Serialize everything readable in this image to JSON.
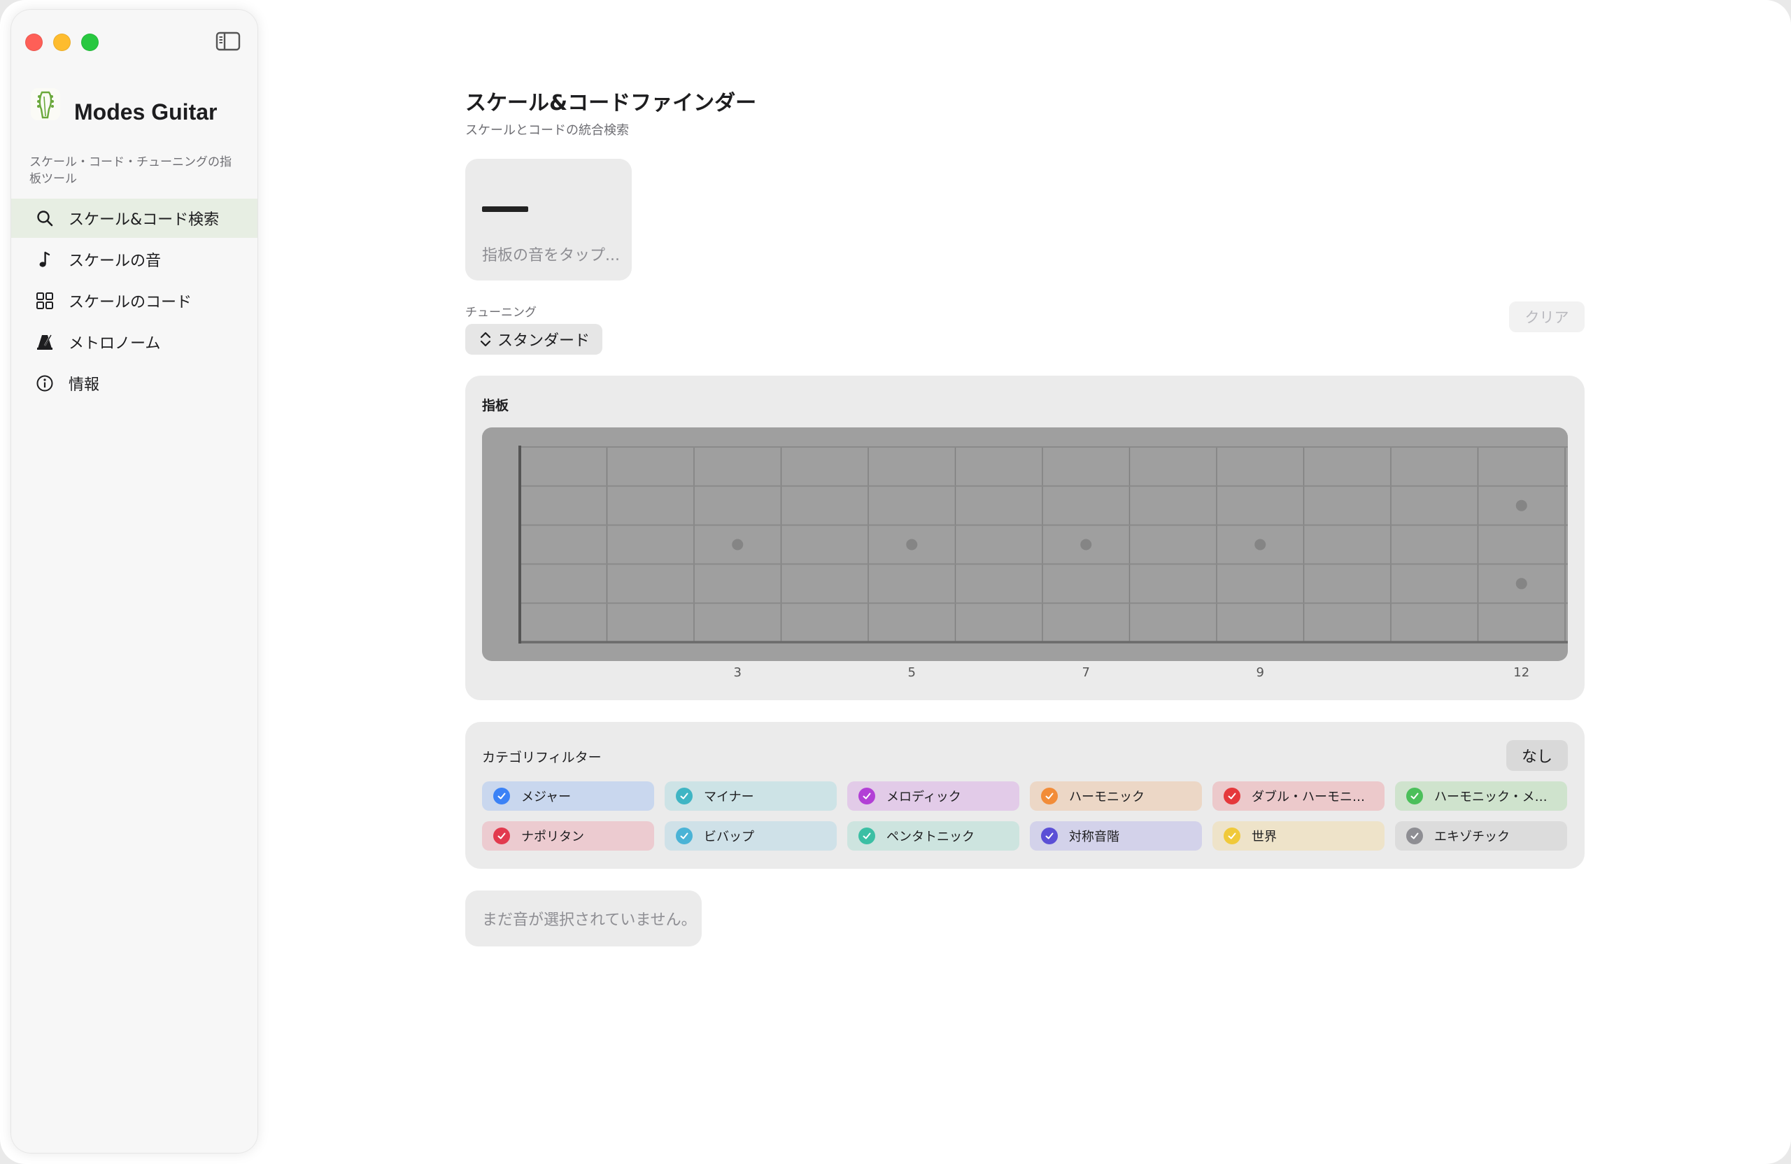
{
  "sidebar": {
    "app_name": "Modes Guitar",
    "app_subtitle": "スケール・コード・チューニングの指板ツール",
    "items": [
      {
        "label": "スケール&コード検索",
        "icon": "search-icon",
        "selected": true
      },
      {
        "label": "スケールの音",
        "icon": "music-note-icon",
        "selected": false
      },
      {
        "label": "スケールのコード",
        "icon": "grid-icon",
        "selected": false
      },
      {
        "label": "メトロノーム",
        "icon": "metronome-icon",
        "selected": false
      },
      {
        "label": "情報",
        "icon": "info-icon",
        "selected": false
      }
    ]
  },
  "main": {
    "title": "スケール&コードファインダー",
    "subtitle": "スケールとコードの統合検索",
    "selection_hint": "指板の音をタップ...",
    "tuning_label": "チューニング",
    "tuning_value": "スタンダード",
    "clear_label": "クリア",
    "fretboard": {
      "title": "指板",
      "strings": 6,
      "frets": 12,
      "markers": [
        3,
        5,
        7,
        9,
        12
      ],
      "marker_labels": [
        "3",
        "5",
        "7",
        "9",
        "12"
      ]
    },
    "filter": {
      "title": "カテゴリフィルター",
      "none_label": "なし",
      "chips": [
        {
          "label": "メジャー",
          "check_color": "#3b82f6",
          "bg": "#c9d7ee"
        },
        {
          "label": "マイナー",
          "check_color": "#3fb5c4",
          "bg": "#cde3e6"
        },
        {
          "label": "メロディック",
          "check_color": "#b23fd6",
          "bg": "#e2cbe8"
        },
        {
          "label": "ハーモニック",
          "check_color": "#f28c38",
          "bg": "#ecd7c6"
        },
        {
          "label": "ダブル・ハーモニ…",
          "check_color": "#e5383b",
          "bg": "#ecc9cb"
        },
        {
          "label": "ハーモニック・メ…",
          "check_color": "#4bbf5a",
          "bg": "#cfe3cd"
        },
        {
          "label": "ナポリタン",
          "check_color": "#e23a4e",
          "bg": "#eccbd0"
        },
        {
          "label": "ビバップ",
          "check_color": "#4ab3d6",
          "bg": "#cfe1e8"
        },
        {
          "label": "ペンタトニック",
          "check_color": "#3bbfa4",
          "bg": "#cde4df"
        },
        {
          "label": "対称音階",
          "check_color": "#5b4fd6",
          "bg": "#d3d2ea"
        },
        {
          "label": "世界",
          "check_color": "#f0c93a",
          "bg": "#eee3c9"
        },
        {
          "label": "エキゾチック",
          "check_color": "#8e8e93",
          "bg": "#dcdcdc"
        }
      ]
    },
    "empty_state": "まだ音が選択されていません。"
  }
}
